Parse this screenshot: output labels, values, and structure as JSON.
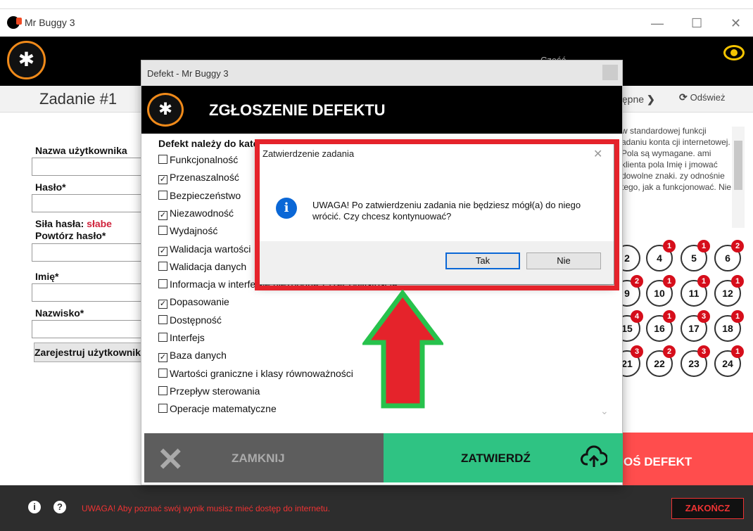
{
  "window": {
    "title": "Mr Buggy 3",
    "min_label": "—",
    "max_label": "☐",
    "close_label": "✕"
  },
  "header": {
    "user_label": "Cześć"
  },
  "task_bar": {
    "title": "Zadanie #1",
    "next_label": "tępne",
    "refresh_label": "Odśwież"
  },
  "form": {
    "username_label": "Nazwa użytkownika",
    "password_label": "Hasło*",
    "strength_label": "Siła hasła:",
    "strength_value": "słabe",
    "repeat_label": "Powtórz hasło*",
    "firstname_label": "Imię*",
    "lastname_label": "Nazwisko*",
    "register_button": "Zarejestruj użytkownika"
  },
  "right_panel": {
    "text": "w standardowej funkcji adaniu konta cji internetowej. Pola są wymagane. ami klienta pola Imię i jmować dowolne znaki. zy odnośnie tego, jak a funkcjonować. Nie",
    "circles": [
      {
        "n": "2",
        "b": ""
      },
      {
        "n": "4",
        "b": "1"
      },
      {
        "n": "5",
        "b": "1"
      },
      {
        "n": "6",
        "b": "2"
      },
      {
        "n": "9",
        "b": "2"
      },
      {
        "n": "10",
        "b": "1"
      },
      {
        "n": "11",
        "b": "1"
      },
      {
        "n": "12",
        "b": "1"
      },
      {
        "n": "15",
        "b": "4"
      },
      {
        "n": "16",
        "b": "1"
      },
      {
        "n": "17",
        "b": "3"
      },
      {
        "n": "18",
        "b": "1"
      },
      {
        "n": "21",
        "b": "3"
      },
      {
        "n": "22",
        "b": "2"
      },
      {
        "n": "23",
        "b": "3"
      },
      {
        "n": "24",
        "b": "1"
      }
    ],
    "report_button": "OŚ DEFEKT"
  },
  "footer": {
    "message": "UWAGA! Aby poznać swój wynik musisz mieć dostęp do internetu.",
    "finish_button": "ZAKOŃCZ"
  },
  "defect_dialog": {
    "title": "Defekt - Mr Buggy 3",
    "heading": "ZGŁOSZENIE DEFEKTU",
    "intro": "Defekt należy do kategorii*",
    "categories": [
      {
        "label": "Funkcjonalność",
        "checked": false
      },
      {
        "label": "Przenaszalność",
        "checked": true
      },
      {
        "label": "Bezpieczeństwo",
        "checked": false
      },
      {
        "label": "Niezawodność",
        "checked": true
      },
      {
        "label": "Wydajność",
        "checked": false
      },
      {
        "label": "Walidacja wartości",
        "checked": true
      },
      {
        "label": "Walidacja danych",
        "checked": false
      },
      {
        "label": "Informacja w interfejsie niezgodna z rzeczywistością",
        "checked": false
      },
      {
        "label": "Dopasowanie",
        "checked": true
      },
      {
        "label": "Dostępność",
        "checked": false
      },
      {
        "label": "Interfejs",
        "checked": false
      },
      {
        "label": "Baza danych",
        "checked": true
      },
      {
        "label": "Wartości graniczne i klasy równoważności",
        "checked": false
      },
      {
        "label": "Przepływ sterowania",
        "checked": false
      },
      {
        "label": "Operacje matematyczne",
        "checked": false
      }
    ],
    "cancel_button": "ZAMKNIJ",
    "confirm_button": "ZATWIERDŹ"
  },
  "modal": {
    "title": "Zatwierdzenie zadania",
    "message": "UWAGA! Po zatwierdzeniu zadania nie będziesz mógł(a) do niego wrócić. Czy chcesz kontynuować?",
    "yes": "Tak",
    "no": "Nie"
  },
  "colors": {
    "accent": "#f08a1a",
    "report": "#ff4d4d",
    "confirm": "#2fc383",
    "highlight": "#e5232b",
    "arrow_fill": "#e5232b",
    "arrow_border": "#27c24c"
  }
}
